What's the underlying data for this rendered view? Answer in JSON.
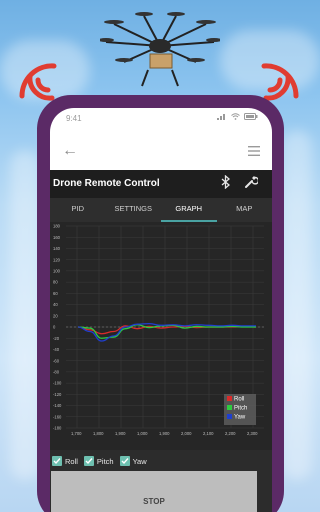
{
  "status_bar": {
    "time": "9:41"
  },
  "app": {
    "title": "Drone Remote Control",
    "tabs": [
      {
        "label": "PID",
        "active": false
      },
      {
        "label": "SETTINGS",
        "active": false
      },
      {
        "label": "GRAPH",
        "active": true
      },
      {
        "label": "MAP",
        "active": false
      }
    ],
    "checkboxes": [
      {
        "label": "Roll",
        "checked": true
      },
      {
        "label": "Pitch",
        "checked": true
      },
      {
        "label": "Yaw",
        "checked": true
      }
    ],
    "stop_label": "STOP"
  },
  "colors": {
    "phone_frame": "#5b2a66",
    "accent": "#4aa3a3",
    "roll": "#d92b2b",
    "pitch": "#2ecc40",
    "yaw": "#1f3fcf",
    "signal": "#e03c31"
  },
  "chart_data": {
    "type": "line",
    "ylim": [
      -180,
      180
    ],
    "y_ticks": [
      "180",
      "160",
      "140",
      "120",
      "100",
      "80",
      "60",
      "40",
      "20",
      "0",
      "-20",
      "-40",
      "-60",
      "-80",
      "-100",
      "-120",
      "-140",
      "-160",
      "-180"
    ],
    "x_ticks": [
      "1,700",
      "1,800",
      "1,900",
      "1,000",
      "1,900",
      "2,000",
      "2,100",
      "2,200",
      "2,300"
    ],
    "legend_placement": "bottom-right",
    "grid": true,
    "series": [
      {
        "name": "Roll",
        "values": [
          0,
          -5,
          -12,
          -8,
          2,
          -3,
          1,
          -2,
          0,
          1,
          -1,
          0,
          0,
          0,
          1,
          0
        ]
      },
      {
        "name": "Pitch",
        "values": [
          0,
          -2,
          -20,
          -18,
          -3,
          4,
          -1,
          2,
          3,
          -2,
          1,
          0,
          0,
          1,
          0,
          0
        ]
      },
      {
        "name": "Yaw",
        "values": [
          0,
          -8,
          -25,
          -16,
          0,
          5,
          6,
          3,
          4,
          2,
          4,
          3,
          2,
          3,
          2,
          2
        ]
      }
    ]
  }
}
